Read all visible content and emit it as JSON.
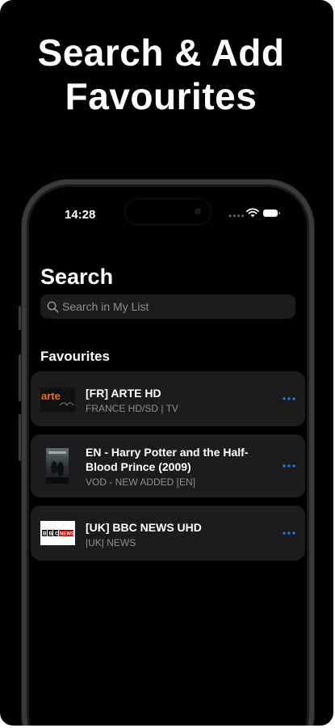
{
  "headline": {
    "line1": "Search & Add",
    "line2": "Favourites"
  },
  "status_bar": {
    "time": "14:28",
    "signal_icon": "cellular-dots-icon",
    "wifi_icon": "wifi-icon",
    "battery_icon": "battery-icon"
  },
  "screen": {
    "title": "Search",
    "search": {
      "placeholder": "Search in My List",
      "icon": "search-icon"
    },
    "section_title": "Favourites"
  },
  "favourites": [
    {
      "title": "[FR] ARTE HD",
      "subtitle": "FRANCE HD/SD | TV",
      "thumbnail": "arte-logo"
    },
    {
      "title": "EN - Harry Potter and the Half-Blood Prince (2009)",
      "subtitle": "VOD - NEW ADDED [EN]",
      "thumbnail": "movie-poster"
    },
    {
      "title": "[UK] BBC NEWS UHD",
      "subtitle": "|UK| NEWS",
      "thumbnail": "bbc-news-logo"
    }
  ],
  "logos": {
    "arte": "arte",
    "bbc": "BBC",
    "news": "NEWS"
  },
  "colors": {
    "background": "#000000",
    "row_background": "#1c1c1e",
    "accent": "#0a84ff",
    "secondary_text": "#8e8e93"
  }
}
